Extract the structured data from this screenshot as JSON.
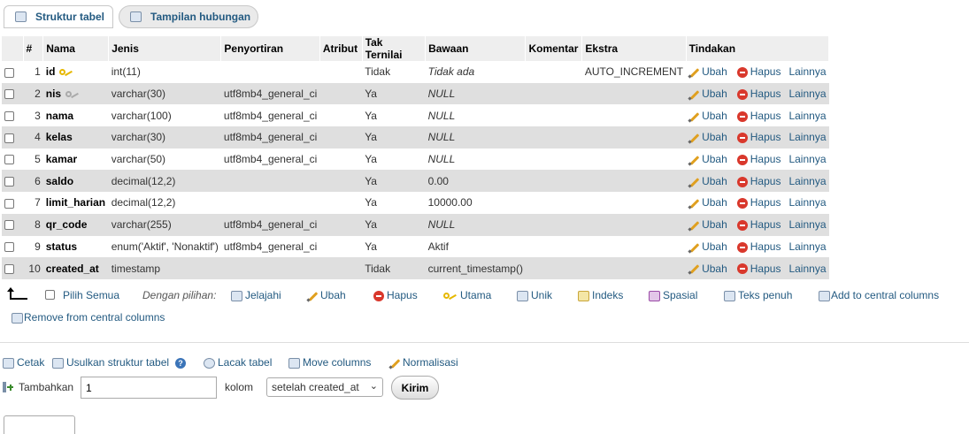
{
  "tabs": {
    "structure": "Struktur tabel",
    "relation": "Tampilan hubungan"
  },
  "columns": [
    "#",
    "Nama",
    "Jenis",
    "Penyortiran",
    "Atribut",
    "Tak Ternilai",
    "Bawaan",
    "Komentar",
    "Ekstra",
    "Tindakan"
  ],
  "rows": [
    {
      "num": "1",
      "name": "id",
      "key": "primary",
      "type": "int(11)",
      "collation": "",
      "attr": "",
      "null": "Tidak",
      "default": "Tidak ada",
      "default_italic": true,
      "comment": "",
      "extra": "AUTO_INCREMENT"
    },
    {
      "num": "2",
      "name": "nis",
      "key": "unique",
      "type": "varchar(30)",
      "collation": "utf8mb4_general_ci",
      "attr": "",
      "null": "Ya",
      "default": "NULL",
      "default_italic": true,
      "comment": "",
      "extra": ""
    },
    {
      "num": "3",
      "name": "nama",
      "key": "",
      "type": "varchar(100)",
      "collation": "utf8mb4_general_ci",
      "attr": "",
      "null": "Ya",
      "default": "NULL",
      "default_italic": true,
      "comment": "",
      "extra": ""
    },
    {
      "num": "4",
      "name": "kelas",
      "key": "",
      "type": "varchar(30)",
      "collation": "utf8mb4_general_ci",
      "attr": "",
      "null": "Ya",
      "default": "NULL",
      "default_italic": true,
      "comment": "",
      "extra": ""
    },
    {
      "num": "5",
      "name": "kamar",
      "key": "",
      "type": "varchar(50)",
      "collation": "utf8mb4_general_ci",
      "attr": "",
      "null": "Ya",
      "default": "NULL",
      "default_italic": true,
      "comment": "",
      "extra": ""
    },
    {
      "num": "6",
      "name": "saldo",
      "key": "",
      "type": "decimal(12,2)",
      "collation": "",
      "attr": "",
      "null": "Ya",
      "default": "0.00",
      "default_italic": false,
      "comment": "",
      "extra": ""
    },
    {
      "num": "7",
      "name": "limit_harian",
      "key": "",
      "type": "decimal(12,2)",
      "collation": "",
      "attr": "",
      "null": "Ya",
      "default": "10000.00",
      "default_italic": false,
      "comment": "",
      "extra": ""
    },
    {
      "num": "8",
      "name": "qr_code",
      "key": "",
      "type": "varchar(255)",
      "collation": "utf8mb4_general_ci",
      "attr": "",
      "null": "Ya",
      "default": "NULL",
      "default_italic": true,
      "comment": "",
      "extra": ""
    },
    {
      "num": "9",
      "name": "status",
      "key": "",
      "type": "enum('Aktif', 'Nonaktif')",
      "collation": "utf8mb4_general_ci",
      "attr": "",
      "null": "Ya",
      "default": "Aktif",
      "default_italic": false,
      "comment": "",
      "extra": ""
    },
    {
      "num": "10",
      "name": "created_at",
      "key": "",
      "type": "timestamp",
      "collation": "",
      "attr": "",
      "null": "Tidak",
      "default": "current_timestamp()",
      "default_italic": false,
      "comment": "",
      "extra": ""
    }
  ],
  "row_actions": {
    "edit": "Ubah",
    "drop": "Hapus",
    "more": "Lainnya"
  },
  "bulk": {
    "check_all": "Pilih Semua",
    "with_selected": "Dengan pilihan:",
    "browse": "Jelajahi",
    "edit": "Ubah",
    "drop": "Hapus",
    "primary": "Utama",
    "unique": "Unik",
    "index": "Indeks",
    "spatial": "Spasial",
    "fulltext": "Teks penuh",
    "add_central": "Add to central columns",
    "remove_central": "Remove from central columns"
  },
  "bottom": {
    "print": "Cetak",
    "propose": "Usulkan struktur tabel",
    "track": "Lacak tabel",
    "move": "Move columns",
    "normalize": "Normalisasi",
    "add_label": "Tambahkan",
    "add_count": "1",
    "columns_label": "kolom",
    "position_selected": "setelah created_at",
    "submit": "Kirim"
  },
  "colors": {
    "accent": "#235a81",
    "header_bg": "#eeeeee",
    "row_alt": "#dfdfdf",
    "drop": "#d9382c"
  }
}
